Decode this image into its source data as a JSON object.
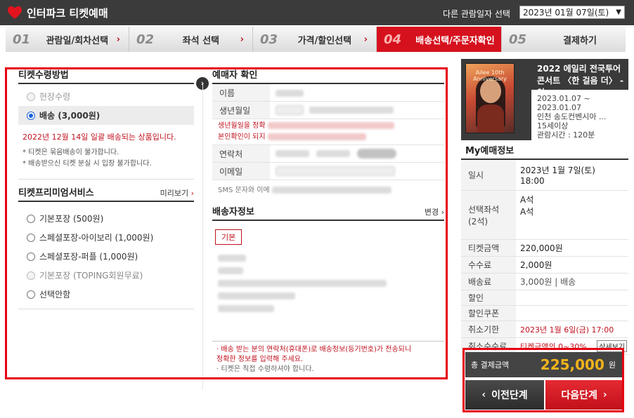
{
  "header": {
    "logo_text": "인터파크 티켓예매",
    "date_label": "다른 관람일자 선택",
    "date_value": "2023년 01월 07일(토)"
  },
  "steps": [
    {
      "num": "01",
      "label": "관람일/회차선택"
    },
    {
      "num": "02",
      "label": "좌석 선택"
    },
    {
      "num": "03",
      "label": "가격/할인선택"
    },
    {
      "num": "04",
      "label": "배송선택/주문자확인"
    },
    {
      "num": "05",
      "label": "결제하기"
    }
  ],
  "receipt": {
    "title": "티켓수령방법",
    "options": [
      {
        "label": "현장수령"
      },
      {
        "label": "배송 (3,000원)"
      }
    ],
    "ship_date": "2022년 12월 14일 일괄 배송되는 상품입니다.",
    "notes": [
      "* 티켓은 묶음배송이 불가합니다.",
      "* 배송받으신 티켓 분실 시 입장 불가합니다."
    ]
  },
  "premium": {
    "title": "티켓프리미엄서비스",
    "more": "미리보기",
    "options": [
      {
        "label": "기본포장 (500원)"
      },
      {
        "label": "스페셜포장-아이보리 (1,000원)"
      },
      {
        "label": "스페셜포장-퍼플 (1,000원)"
      },
      {
        "label": "기본포장 (TOPING회원무료)"
      },
      {
        "label": "선택안함"
      }
    ]
  },
  "buyer": {
    "title": "예매자 확인",
    "name_label": "이름",
    "birth_label": "생년월일",
    "birth_warning_1": "생년월일을 정확",
    "birth_warning_2": "본인확인이 되지",
    "contact_label": "연락처",
    "email_label": "이메일",
    "sms_note": "SMS 문자와 이메"
  },
  "shipping": {
    "title": "배송자정보",
    "edit": "변경",
    "badge": "기본",
    "note_1": "· 배송 받는 분의 연락처(휴대폰)로 배송정보(등기번호)가 전송되니",
    "note_2": "  정확한 정보를 입력해 주세요.",
    "note_3": "· 티켓은 직접 수령하셔야 합니다."
  },
  "performance": {
    "title_line1": "2022 에일리 전국투어",
    "title_line2": "콘서트 〈한 걸음 더〉 - 인",
    "date_from": "2023.01.07 ~",
    "date_to": "2023.01.07",
    "venue": "인천 송도컨벤시아 ...",
    "age": "15세이상",
    "runtime": "관람시간 : 120분",
    "poster_text": "Ailee 10th Anniversary"
  },
  "my_info": {
    "title": "My예매정보",
    "rows": {
      "date_k": "일시",
      "date_v1": "2023년 1월 7일(토)",
      "date_v2": "18:00",
      "seat_k1": "선택좌석",
      "seat_k2": "(2석)",
      "seat_v1": "A석",
      "seat_v2": "A석",
      "ticket_k": "티켓금액",
      "ticket_v": "220,000원",
      "fee_k": "수수료",
      "fee_v": "2,000원",
      "ship_k": "배송료",
      "ship_v": "3,000원 | 배송",
      "disc_k": "할인",
      "coupon_k": "할인쿠폰",
      "cancel_k": "취소기한",
      "cancel_v": "2023년 1월 6일(금) 17:00",
      "cfee_k": "취소수수료",
      "cfee_v": "티켓금액의 0~30%",
      "cfee_btn": "상세보기"
    }
  },
  "total": {
    "label": "총 결제금액",
    "amount": "225,000",
    "unit": "원"
  },
  "buttons": {
    "prev": "이전단계",
    "next": "다음단계"
  },
  "colors": {
    "accent_red": "#d6111e",
    "amount_yellow": "#f2b31b",
    "header_dark": "#3b3b3b"
  }
}
